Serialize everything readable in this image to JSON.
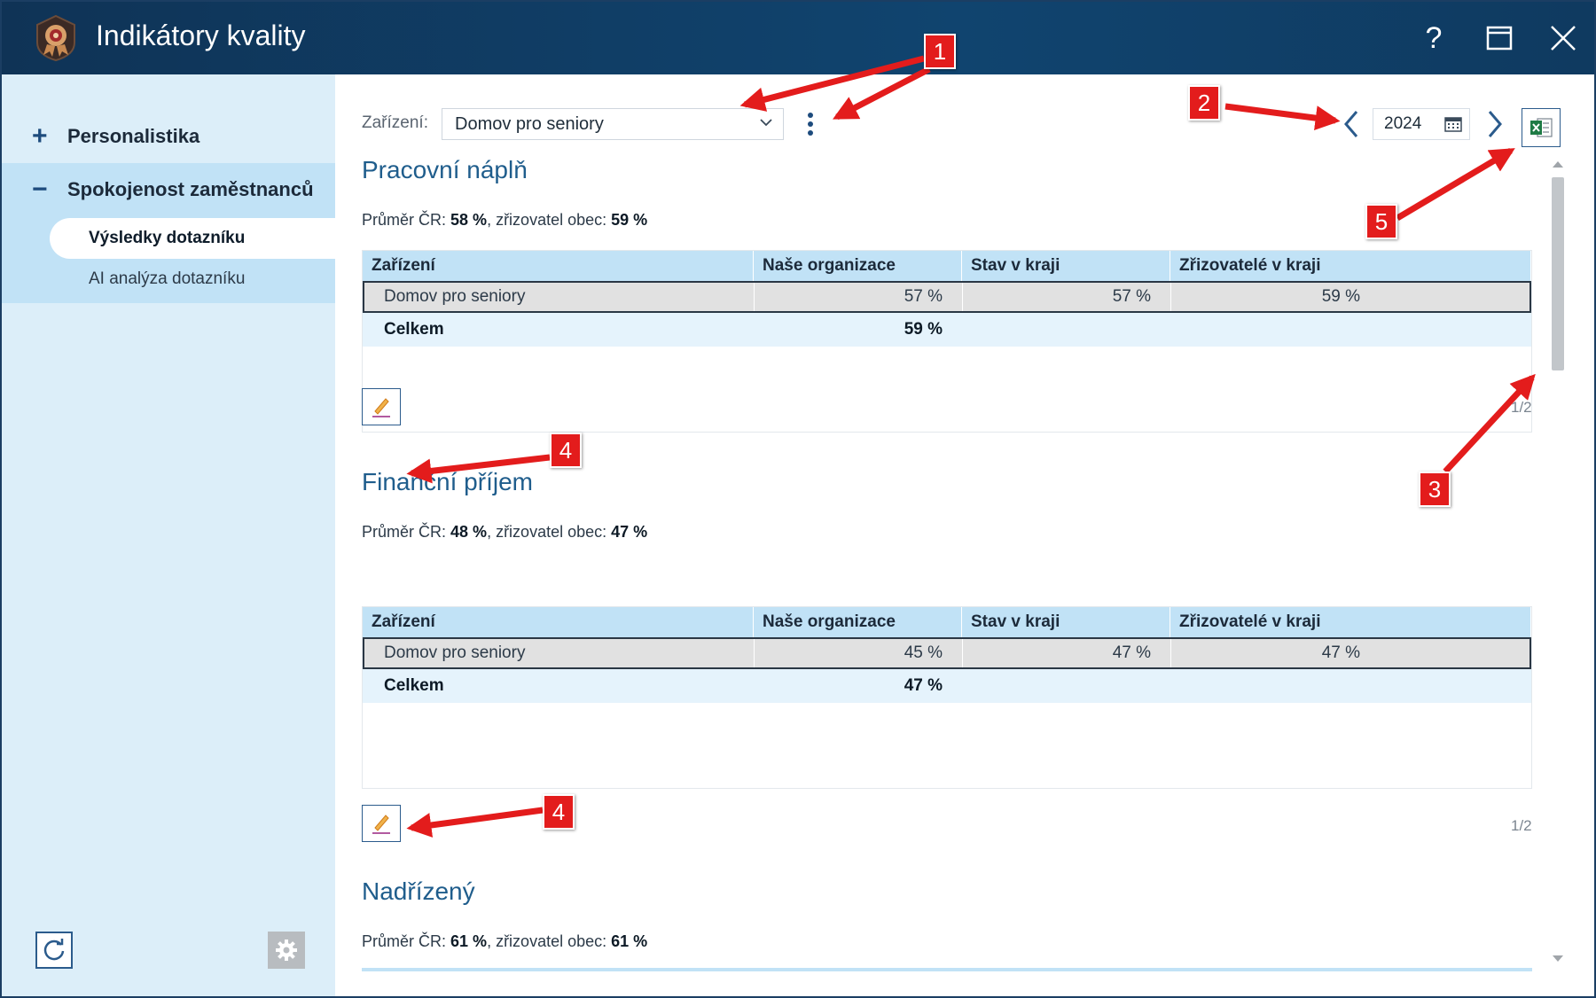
{
  "window": {
    "title": "Indikátory kvality",
    "help_label": "?",
    "controls": [
      "help-icon",
      "maximize-icon",
      "close-icon"
    ]
  },
  "sidebar": {
    "groups": [
      {
        "toggle": "+",
        "label": "Personalistika",
        "expanded": false
      },
      {
        "toggle": "−",
        "label": "Spokojenost zaměstnanců",
        "expanded": true,
        "items": [
          {
            "label": "Výsledky dotazníku",
            "active": true
          },
          {
            "label": "AI analýza dotazníku",
            "active": false
          }
        ]
      }
    ],
    "bottom_buttons": [
      "refresh-icon",
      "gear-icon"
    ]
  },
  "toolbar": {
    "facility_label": "Zařízení:",
    "facility_value": "Domov pro seniory",
    "year": "2024"
  },
  "table_headers": [
    "Zařízení",
    "Naše organizace",
    "Stav v kraji",
    "Zřizovatelé v kraji"
  ],
  "sections": [
    {
      "title": "Pracovní náplň",
      "avg_prefix": "Průměr ČR:",
      "avg_cr": "58 %",
      "avg_mid": ", zřizovatel obec:",
      "avg_obec": "59 %",
      "row": {
        "facility": "Domov pro seniory",
        "org": "57 %",
        "kraj": "57 %",
        "zrizovatele": "59 %"
      },
      "total": {
        "label": "Celkem",
        "org": "59 %"
      },
      "pager": "1/2"
    },
    {
      "title": "Finanční příjem",
      "avg_prefix": "Průměr ČR:",
      "avg_cr": "48 %",
      "avg_mid": ", zřizovatel obec:",
      "avg_obec": "47 %",
      "row": {
        "facility": "Domov pro seniory",
        "org": "45 %",
        "kraj": "47 %",
        "zrizovatele": "47 %"
      },
      "total": {
        "label": "Celkem",
        "org": "47 %"
      },
      "pager": "1/2"
    },
    {
      "title": "Nadřízený",
      "avg_prefix": "Průměr ČR:",
      "avg_cr": "61 %",
      "avg_mid": ", zřizovatel obec:",
      "avg_obec": "61 %"
    }
  ],
  "annotations": [
    "1",
    "2",
    "3",
    "4",
    "4",
    "5"
  ],
  "colors": {
    "titlebar": "#10446f",
    "sidebar": "#dceef9",
    "header_row": "#c1e2f6",
    "accent_title": "#1f5d8c",
    "annotation_red": "#e31c1c"
  }
}
